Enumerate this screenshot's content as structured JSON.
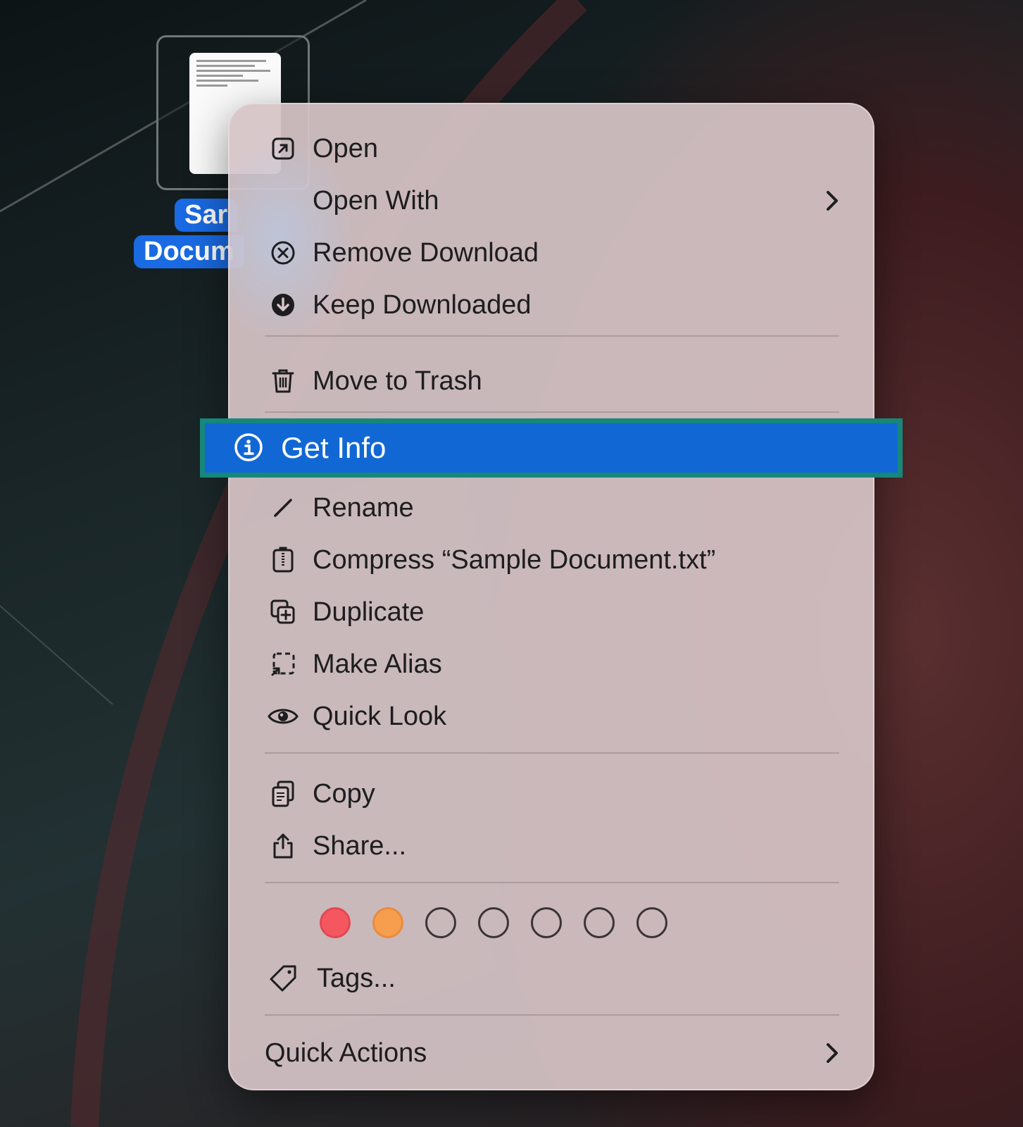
{
  "desktop_file": {
    "label_line1": "Sar",
    "label_line2": "Docum"
  },
  "menu": {
    "open": "Open",
    "open_with": "Open With",
    "remove_download": "Remove Download",
    "keep_downloaded": "Keep Downloaded",
    "move_to_trash": "Move to Trash",
    "get_info": "Get Info",
    "rename": "Rename",
    "compress": "Compress “Sample Document.txt”",
    "duplicate": "Duplicate",
    "make_alias": "Make Alias",
    "quick_look": "Quick Look",
    "copy": "Copy",
    "share": "Share...",
    "tags": "Tags...",
    "quick_actions": "Quick Actions"
  },
  "tag_colors": [
    "#f4575f",
    "#f79d4e",
    "none",
    "none",
    "none",
    "none",
    "none"
  ],
  "colors": {
    "highlight": "#1168d4",
    "highlight_outline": "#16877a",
    "selection_label": "#1a6ae3"
  }
}
